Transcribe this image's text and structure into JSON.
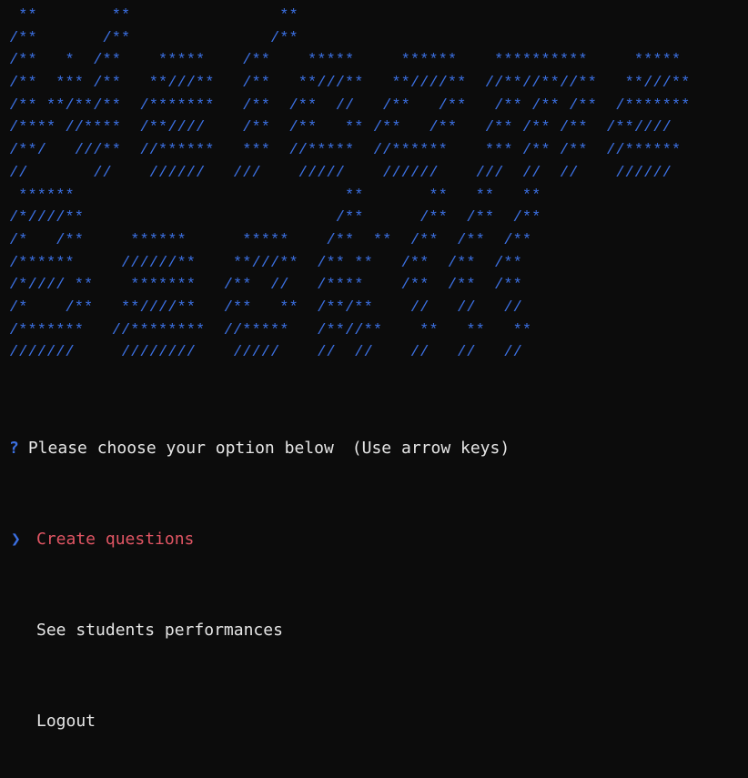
{
  "colors": {
    "background": "#0c0c0c",
    "banner": "#3b6fe0",
    "text": "#e6e6e6",
    "selected": "#e05563",
    "pointer": "#3b6fe0"
  },
  "banner_lines": [
    " **        **                **",
    "/**       /**               /**",
    "/**   *  /**    *****    /**    *****     ******    **********     *****",
    "/**  *** /**   **///**   /**   **///**   **////**  //**//**//**   **///**",
    "/** **/**/**  /*******   /**  /**  //   /**   /**   /** /** /**  /*******",
    "/**** //****  /**////    /**  /**   ** /**   /**   /** /** /**  /**////",
    "/**/   ///**  //******   ***  //*****  //******    *** /** /**  //******",
    "//       //    //////   ///    /////    //////    ///  //  //    //////",
    " ******                             **       **   **   **",
    "/*////**                           /**      /**  /**  /**",
    "/*   /**     ******      *****    /**  **  /**  /**  /**",
    "/******     //////**    **///**  /** **   /**  /**  /**",
    "/*//// **    *******   /**  //   /****    /**  /**  /**",
    "/*    /**   **////**   /**   **  /**/**    //   //   //",
    "/*******   //********  //*****   /**//**    **   **   **",
    "///////     ////////    /////    //  //    //   //   //"
  ],
  "prompt": {
    "symbol": "?",
    "question": "Please choose your option below",
    "hint": "(Use arrow keys)"
  },
  "menu": {
    "pointer": "❯",
    "selected_index": 0,
    "options": [
      "Create questions",
      "See students performances",
      "Logout"
    ]
  }
}
